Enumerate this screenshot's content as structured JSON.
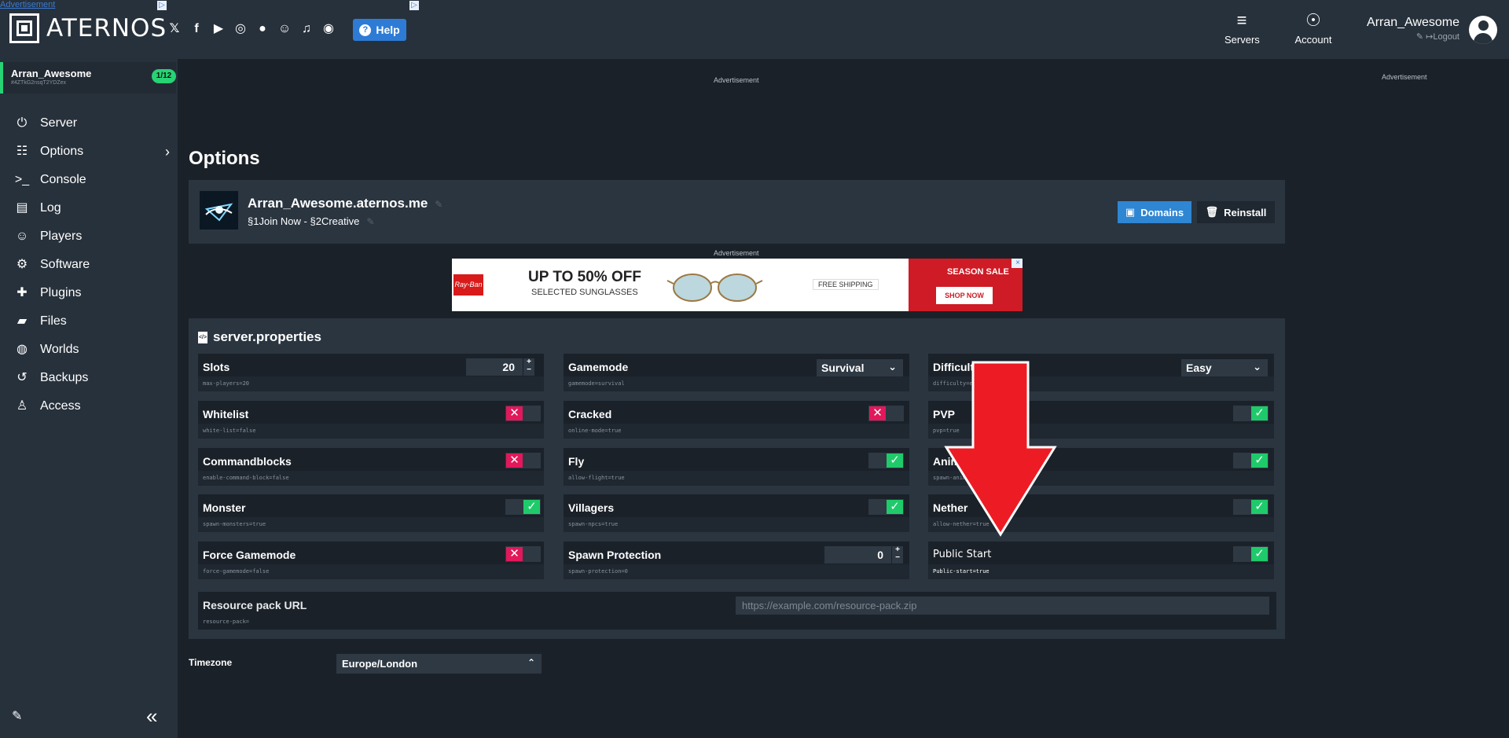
{
  "header": {
    "broken_ad": "Advertisement",
    "brand": "ATERNOS",
    "social_icons": [
      "twitter-icon",
      "facebook-icon",
      "youtube-icon",
      "instagram-icon",
      "reddit-icon",
      "discord-icon",
      "support-icon",
      "github-icon"
    ],
    "help_label": "Help",
    "nav": [
      {
        "label": "Servers",
        "icon": "servers-icon"
      },
      {
        "label": "Account",
        "icon": "account-icon"
      }
    ],
    "username": "Arran_Awesome",
    "logout_label": "Logout"
  },
  "sidebar": {
    "server_name": "Arran_Awesome",
    "server_id": "#4ZTkG2nsqT2YDZex",
    "player_badge": "1/12",
    "items": [
      {
        "label": "Server",
        "icon": "power-icon"
      },
      {
        "label": "Options",
        "icon": "sliders-icon"
      },
      {
        "label": "Console",
        "icon": "terminal-icon"
      },
      {
        "label": "Log",
        "icon": "file-icon"
      },
      {
        "label": "Players",
        "icon": "users-icon"
      },
      {
        "label": "Software",
        "icon": "gears-icon"
      },
      {
        "label": "Plugins",
        "icon": "puzzle-icon"
      },
      {
        "label": "Files",
        "icon": "folder-icon"
      },
      {
        "label": "Worlds",
        "icon": "globe-icon"
      },
      {
        "label": "Backups",
        "icon": "history-icon"
      },
      {
        "label": "Access",
        "icon": "user-lock-icon"
      }
    ]
  },
  "ads": {
    "label": "Advertisement",
    "banner_headline": "UP TO 50% OFF",
    "banner_subline": "SELECTED SUNGLASSES",
    "banner_shipping": "FREE SHIPPING",
    "banner_sale": "SEASON SALE",
    "banner_cta": "SHOP NOW",
    "banner_brand": "Ray-Ban"
  },
  "page": {
    "title": "Options",
    "server_address": "Arran_Awesome.aternos.me",
    "motd": "§1Join Now - §2Creative",
    "domains_label": "Domains",
    "reinstall_label": "Reinstall",
    "properties_title": "server.properties",
    "timezone_label": "Timezone",
    "timezone_value": "Europe/London",
    "resource_pack_label": "Resource pack URL",
    "resource_pack_placeholder": "https://example.com/resource-pack.zip",
    "resource_pack_key": "resource-pack="
  },
  "properties": [
    {
      "label": "Slots",
      "key": "max-players=20",
      "type": "number",
      "value": "20"
    },
    {
      "label": "Gamemode",
      "key": "gamemode=survival",
      "type": "select",
      "value": "Survival"
    },
    {
      "label": "Difficulty",
      "key": "difficulty=easy",
      "type": "select",
      "value": "Easy"
    },
    {
      "label": "Whitelist",
      "key": "white-list=false",
      "type": "toggle",
      "value": false
    },
    {
      "label": "Cracked",
      "key": "online-mode=true",
      "type": "toggle",
      "value": false
    },
    {
      "label": "PVP",
      "key": "pvp=true",
      "type": "toggle",
      "value": true
    },
    {
      "label": "Commandblocks",
      "key": "enable-command-block=false",
      "type": "toggle",
      "value": false
    },
    {
      "label": "Fly",
      "key": "allow-flight=true",
      "type": "toggle",
      "value": true
    },
    {
      "label": "Animals",
      "key": "spawn-animals=true",
      "type": "toggle",
      "value": true
    },
    {
      "label": "Monster",
      "key": "spawn-monsters=true",
      "type": "toggle",
      "value": true
    },
    {
      "label": "Villagers",
      "key": "spawn-npcs=true",
      "type": "toggle",
      "value": true
    },
    {
      "label": "Nether",
      "key": "allow-nether=true",
      "type": "toggle",
      "value": true
    },
    {
      "label": "Force Gamemode",
      "key": "force-gamemode=false",
      "type": "toggle",
      "value": false
    },
    {
      "label": "Spawn Protection",
      "key": "spawn-protection=0",
      "type": "number",
      "value": "0"
    },
    {
      "label": "Public Start",
      "key": "Public-start=true",
      "type": "toggle",
      "value": true
    }
  ],
  "colors": {
    "accent_green": "#1fca6a",
    "accent_blue": "#2f86d3",
    "off_red": "#e2185a",
    "arrow_red": "#ed1c24"
  }
}
